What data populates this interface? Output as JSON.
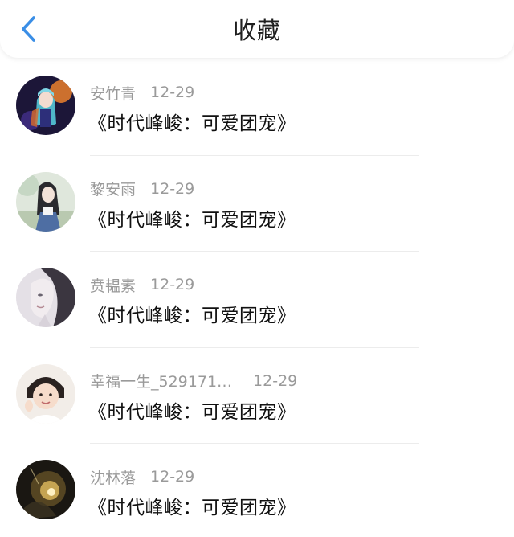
{
  "header": {
    "title": "收藏",
    "back_icon": "chevron-left-icon",
    "accent_color": "#3a8ee6"
  },
  "items": [
    {
      "name": "安竹青",
      "date": "12-29",
      "content": "《时代峰峻：可爱团宠》",
      "avatar": "anime-character-avatar"
    },
    {
      "name": "黎安雨",
      "date": "12-29",
      "content": "《时代峰峻：可爱团宠》",
      "avatar": "illustrated-girl-avatar"
    },
    {
      "name": "贲韫素",
      "date": "12-29",
      "content": "《时代峰峻：可爱团宠》",
      "avatar": "portrait-sketch-avatar"
    },
    {
      "name": "幸福一生_529171…",
      "date": "12-29",
      "content": "《时代峰峻：可爱团宠》",
      "avatar": "child-photo-avatar"
    },
    {
      "name": "沈林落",
      "date": "12-29",
      "content": "《时代峰峻：可爱团宠》",
      "avatar": "golden-light-avatar"
    }
  ]
}
